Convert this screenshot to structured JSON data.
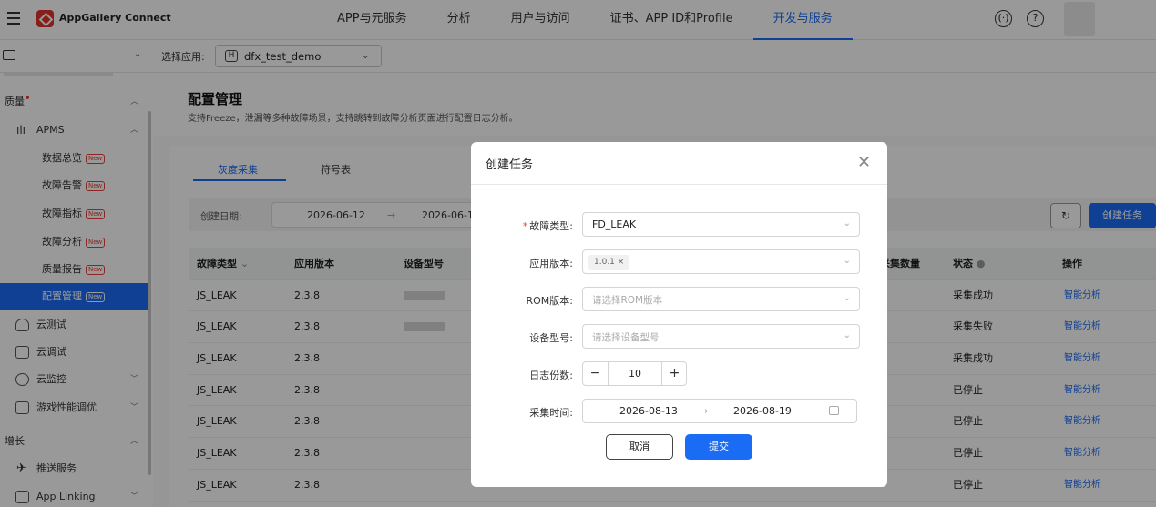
{
  "header": {
    "brand": "AppGallery Connect",
    "nav": [
      "APP与元服务",
      "分析",
      "用户与访问",
      "证书、APP ID和Profile",
      "开发与服务"
    ],
    "active_nav": "开发与服务",
    "icons": [
      "menu-icon",
      "logo-icon",
      "broadcast-icon",
      "help-icon"
    ]
  },
  "subbar": {
    "select_label": "选择应用:",
    "app_badge": "H",
    "app_name": "dfx_test_demo"
  },
  "sidebar": {
    "quality": "质量",
    "apms": "APMS",
    "items": [
      {
        "label": "数据总览",
        "badge": "New"
      },
      {
        "label": "故障告警",
        "badge": "New"
      },
      {
        "label": "故障指标",
        "badge": "New"
      },
      {
        "label": "故障分析",
        "badge": "New"
      },
      {
        "label": "质量报告",
        "badge": "New"
      },
      {
        "label": "配置管理",
        "badge": "New"
      }
    ],
    "cloud_test": "云测试",
    "cloud_debug": "云调试",
    "cloud_monitor": "云监控",
    "game_perf": "游戏性能调优",
    "growth": "增长",
    "push": "推送服务",
    "app_linking": "App Linking"
  },
  "page": {
    "title": "配置管理",
    "desc": "支持Freeze，泄漏等多种故障场景，支持跳转到故障分析页面进行配置日志分析。",
    "tabs": [
      "灰度采集",
      "符号表"
    ],
    "filter_label": "创建日期:",
    "date_from": "2026-06-12",
    "date_sep": "→",
    "date_to": "2026-06-1",
    "create_btn": "创建任务",
    "columns": [
      "故障类型",
      "应用版本",
      "设备型号",
      "采集数量",
      "状态",
      "操作"
    ],
    "rows": [
      {
        "type": "JS_LEAK",
        "version": "2.3.8",
        "status": "采集成功",
        "action": "智能分析"
      },
      {
        "type": "JS_LEAK",
        "version": "2.3.8",
        "status": "采集失败",
        "action": "智能分析"
      },
      {
        "type": "JS_LEAK",
        "version": "2.3.8",
        "status": "采集成功",
        "action": "智能分析"
      },
      {
        "type": "JS_LEAK",
        "version": "2.3.8",
        "status": "已停止",
        "action": "智能分析"
      },
      {
        "type": "JS_LEAK",
        "version": "2.3.8",
        "status": "已停止",
        "action": "智能分析"
      },
      {
        "type": "JS_LEAK",
        "version": "2.3.8",
        "status": "已停止",
        "action": "智能分析"
      },
      {
        "type": "JS_LEAK",
        "version": "2.3.8",
        "status": "已停止",
        "action": "智能分析"
      }
    ]
  },
  "modal": {
    "title": "创建任务",
    "fault_type_label": "故障类型:",
    "fault_type_value": "FD_LEAK",
    "app_version_label": "应用版本:",
    "app_version_tag": "1.0.1 ×",
    "rom_label": "ROM版本:",
    "rom_placeholder": "请选择ROM版本",
    "device_label": "设备型号:",
    "device_placeholder": "请选择设备型号",
    "log_count_label": "日志份数:",
    "log_count_minus": "−",
    "log_count_value": "10",
    "log_count_plus": "+",
    "time_label": "采集时间:",
    "time_from": "2026-08-13",
    "time_sep": "→",
    "time_to": "2026-08-19",
    "cancel": "取消",
    "submit": "提交"
  }
}
